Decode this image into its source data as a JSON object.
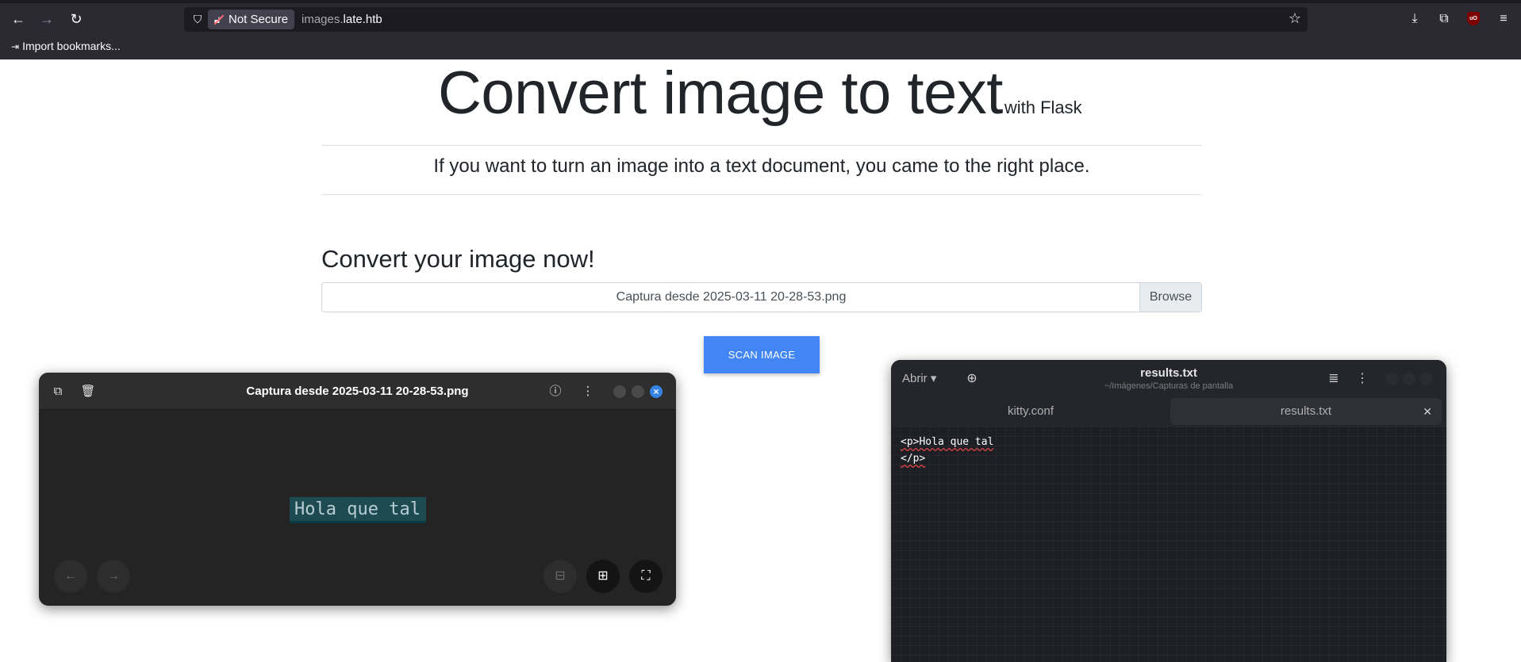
{
  "browser": {
    "security_label": "Not Secure",
    "url_subdomain": "images.",
    "url_domain": "late.htb",
    "bookmarks_label": "Import bookmarks..."
  },
  "page": {
    "title": "Convert image to text",
    "title_suffix": "with Flask",
    "lead": "If you want to turn an image into a text document, you came to the right place.",
    "section_title": "Convert your image now!",
    "file_name": "Captura desde 2025-03-11 20-28-53.png",
    "browse_label": "Browse",
    "scan_button": "SCAN IMAGE"
  },
  "viewer": {
    "title": "Captura desde 2025-03-11 20-28-53.png",
    "image_text": "Hola que tal"
  },
  "editor": {
    "open_label": "Abrir",
    "title": "results.txt",
    "path": "~/Imágenes/Capturas de pantalla",
    "tabs": [
      {
        "label": "kitty.conf"
      },
      {
        "label": "results.txt"
      }
    ],
    "code_lines": [
      "<p>Hola que tal",
      "</p>"
    ]
  },
  "colors": {
    "scan_button": "#4285f4",
    "browser_chrome": "#2b2a33",
    "viewer_close": "#3584e4"
  }
}
